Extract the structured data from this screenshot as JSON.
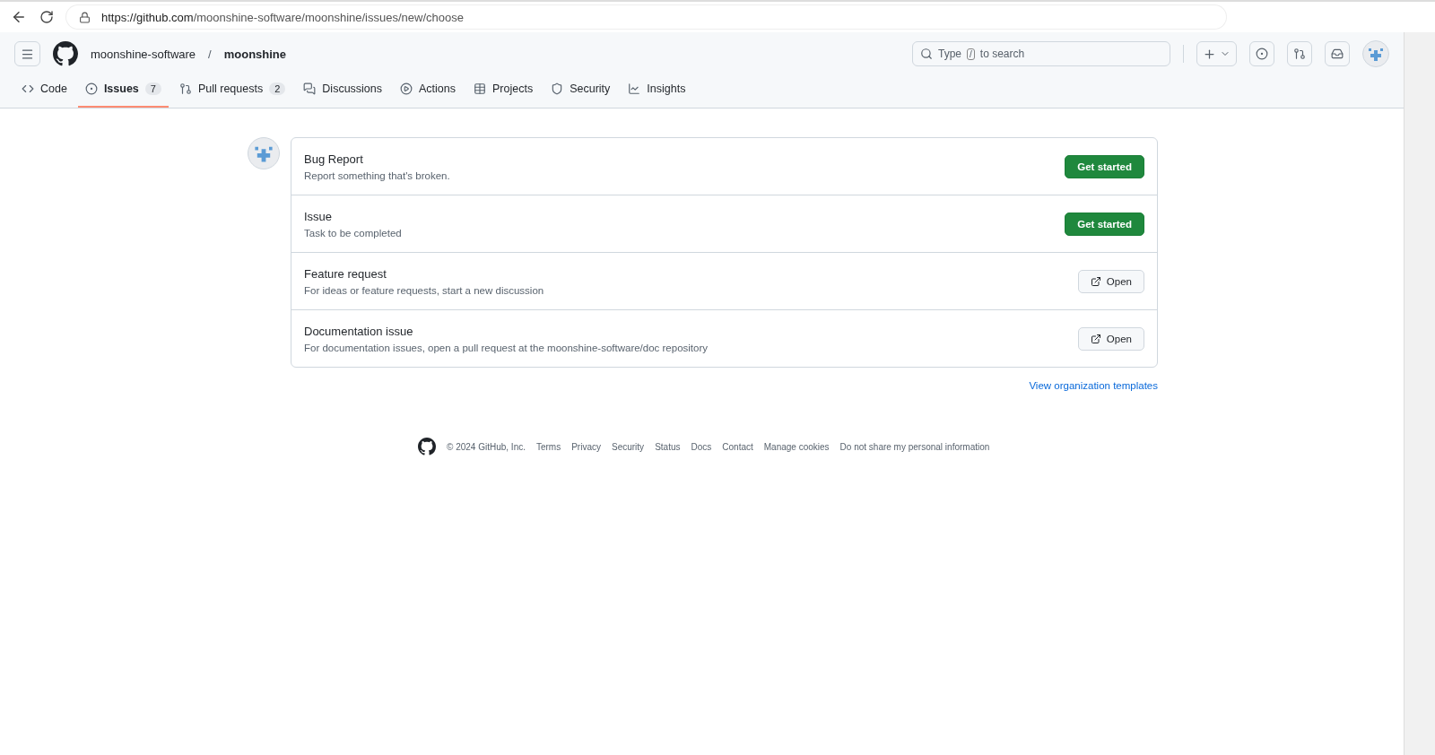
{
  "browser": {
    "url_host": "https://github.com",
    "url_path": "/moonshine-software/moonshine/issues/new/choose"
  },
  "header": {
    "owner": "moonshine-software",
    "separator": "/",
    "repo": "moonshine",
    "search": {
      "hint_start": "Type",
      "key": "/",
      "hint_end": "to search"
    }
  },
  "tabs": [
    {
      "label": "Code",
      "selected": false
    },
    {
      "label": "Issues",
      "count": "7",
      "selected": true
    },
    {
      "label": "Pull requests",
      "count": "2",
      "selected": false
    },
    {
      "label": "Discussions",
      "selected": false
    },
    {
      "label": "Actions",
      "selected": false
    },
    {
      "label": "Projects",
      "selected": false
    },
    {
      "label": "Security",
      "selected": false
    },
    {
      "label": "Insights",
      "selected": false
    }
  ],
  "templates": [
    {
      "title": "Bug Report",
      "description": "Report something that's broken.",
      "kind": "form",
      "action": "Get started"
    },
    {
      "title": "Issue",
      "description": "Task to be completed",
      "kind": "form",
      "action": "Get started"
    },
    {
      "title": "Feature request",
      "description": "For ideas or feature requests, start a new discussion",
      "kind": "external",
      "action": "Open"
    },
    {
      "title": "Documentation issue",
      "description": "For documentation issues, open a pull request at the moonshine-software/doc repository",
      "kind": "external",
      "action": "Open"
    }
  ],
  "org_templates_link": "View organization templates",
  "footer": {
    "copyright": "© 2024 GitHub, Inc.",
    "links": [
      "Terms",
      "Privacy",
      "Security",
      "Status",
      "Docs",
      "Contact",
      "Manage cookies",
      "Do not share my personal information"
    ]
  }
}
